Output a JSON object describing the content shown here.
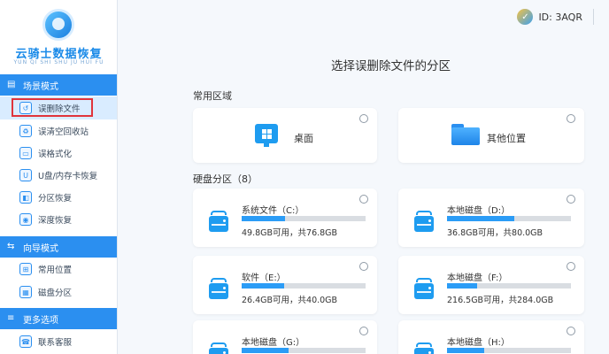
{
  "app": {
    "logo_title": "云骑士数据恢复",
    "logo_subtitle": "YUN QI SHI SHU JU HUI FU"
  },
  "user": {
    "id_text": "ID: 3AQR"
  },
  "sidebar": {
    "sections": [
      {
        "title": "场景模式",
        "icon": "inbox-icon",
        "items": [
          {
            "label": "误删除文件",
            "icon": "file-restore-icon",
            "active": true
          },
          {
            "label": "误清空回收站",
            "icon": "recycle-bin-icon"
          },
          {
            "label": "误格式化",
            "icon": "format-icon"
          },
          {
            "label": "U盘/内存卡恢复",
            "icon": "usb-icon"
          },
          {
            "label": "分区恢复",
            "icon": "partition-icon"
          },
          {
            "label": "深度恢复",
            "icon": "deep-scan-icon"
          }
        ]
      },
      {
        "title": "向导模式",
        "icon": "signpost-icon",
        "items": [
          {
            "label": "常用位置",
            "icon": "windows-icon"
          },
          {
            "label": "磁盘分区",
            "icon": "disk-icon"
          }
        ]
      },
      {
        "title": "更多选项",
        "icon": "menu-icon",
        "items": [
          {
            "label": "联系客服",
            "icon": "headset-icon"
          }
        ]
      }
    ]
  },
  "main": {
    "title": "选择误删除文件的分区",
    "common_label": "常用区域",
    "common": [
      {
        "label": "桌面",
        "icon": "desktop-icon"
      },
      {
        "label": "其他位置",
        "icon": "folder-icon"
      }
    ],
    "partitions_label": "硬盘分区（8）",
    "partitions": [
      {
        "name": "系统文件（C:）",
        "capacity": "49.8GB可用，共76.8GB",
        "used_fraction": 0.35
      },
      {
        "name": "本地磁盘（D:）",
        "capacity": "36.8GB可用，共80.0GB",
        "used_fraction": 0.54
      },
      {
        "name": "软件（E:）",
        "capacity": "26.4GB可用，共40.0GB",
        "used_fraction": 0.34
      },
      {
        "name": "本地磁盘（F:）",
        "capacity": "216.5GB可用，共284.0GB",
        "used_fraction": 0.24
      },
      {
        "name": "本地磁盘（G:）",
        "capacity": "",
        "used_fraction": 0.38
      },
      {
        "name": "本地磁盘（H:）",
        "capacity": "",
        "used_fraction": 0.3
      }
    ]
  }
}
